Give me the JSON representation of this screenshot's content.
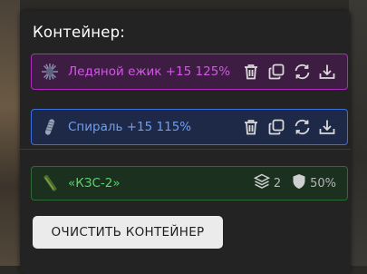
{
  "container": {
    "title": "Контейнер:",
    "items": [
      {
        "label": "Ледяной ежик +15 125%",
        "color": "#d257e6",
        "icon": "spiky-creature-icon"
      },
      {
        "label": "Спираль +15 115%",
        "color": "#6e9ff2",
        "icon": "spiral-item-icon"
      }
    ],
    "item_actions": [
      "trash-icon",
      "copy-icon",
      "refresh-icon",
      "download-icon"
    ],
    "extra_item": {
      "label": "«КЗС-2»",
      "color": "#5cd36c",
      "icon": "green-pipe-icon",
      "stack_count": "2",
      "protection": "50%"
    },
    "clear_button_label": "ОЧИСТИТЬ КОНТЕЙНЕР"
  }
}
